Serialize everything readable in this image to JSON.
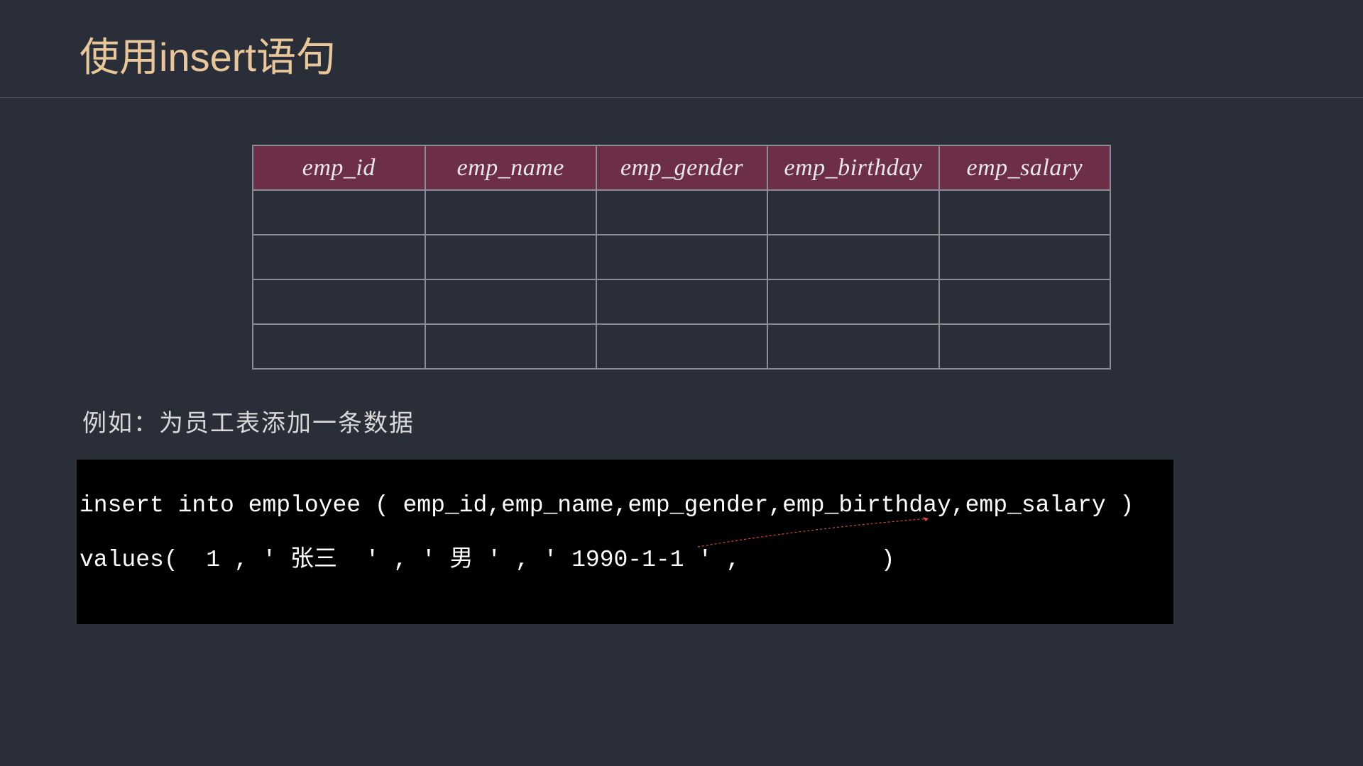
{
  "title": "使用insert语句",
  "table": {
    "headers": [
      "emp_id",
      "emp_name",
      "emp_gender",
      "emp_birthday",
      "emp_salary"
    ],
    "rows": [
      [
        "",
        "",
        "",
        "",
        ""
      ],
      [
        "",
        "",
        "",
        "",
        ""
      ],
      [
        "",
        "",
        "",
        "",
        ""
      ],
      [
        "",
        "",
        "",
        "",
        ""
      ]
    ]
  },
  "example_label": "例如：为员工表添加一条数据",
  "code": {
    "line1": "insert into employee ( emp_id,emp_name,emp_gender,emp_birthday,emp_salary )",
    "line2": "values(  1 , ' 张三  ' , ' 男 ' , ' 1990-1-1 ' ,          )"
  }
}
